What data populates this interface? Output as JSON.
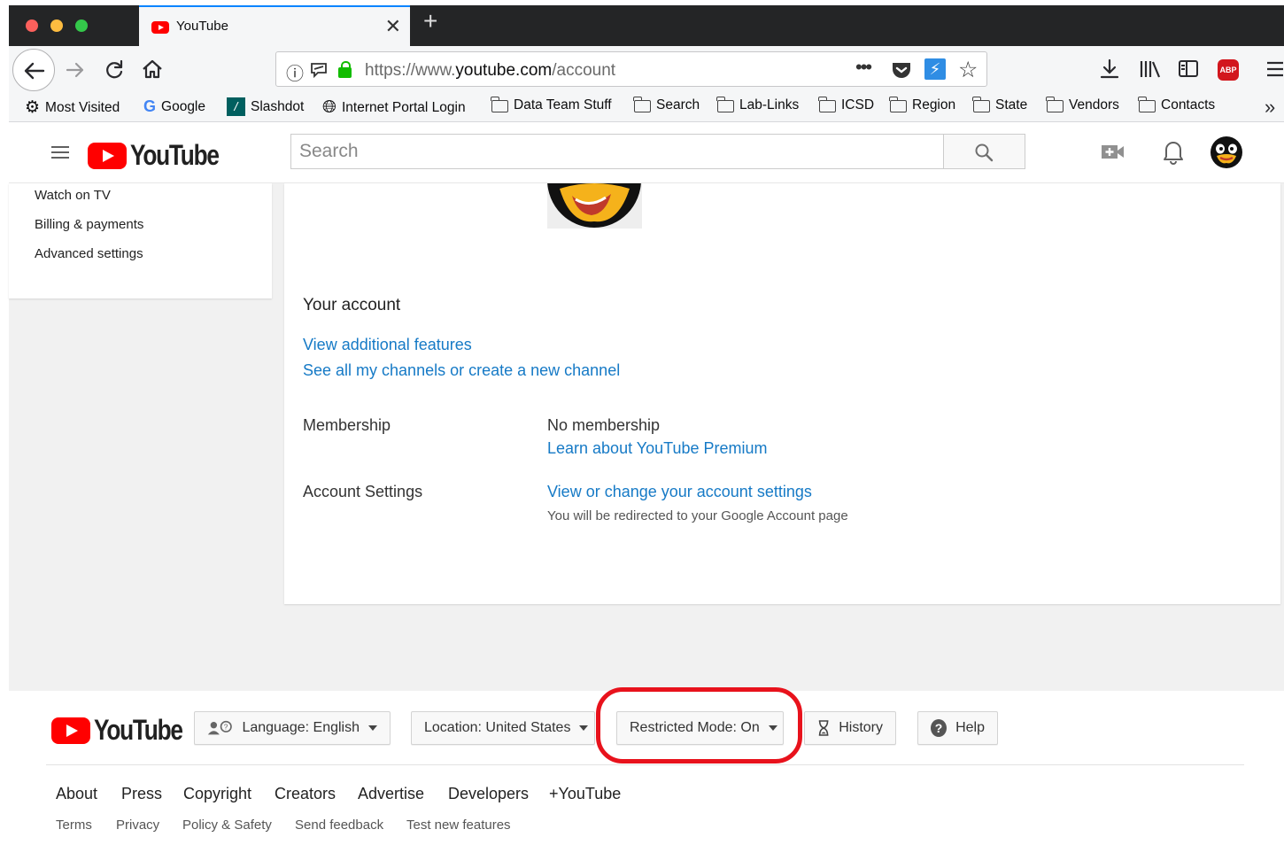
{
  "browser": {
    "tab_title": "YouTube",
    "url_prefix": "https://www.",
    "url_host": "youtube.com",
    "url_path": "/account",
    "abp_label": "ABP",
    "bookmarks": [
      "Most Visited",
      "Google",
      "Slashdot",
      "Internet Portal Login",
      "Data Team Stuff",
      "Search",
      "Lab-Links",
      "ICSD",
      "Region",
      "State",
      "Vendors",
      "Contacts"
    ]
  },
  "masthead": {
    "logo_text": "YouTube",
    "search_placeholder": "Search"
  },
  "sidebar": {
    "items": [
      "Watch on TV",
      "Billing & payments",
      "Advanced settings"
    ]
  },
  "account": {
    "title": "Your account",
    "view_features": "View additional features",
    "see_channels": "See all my channels or create a new channel",
    "membership_label": "Membership",
    "membership_value": "No membership",
    "membership_link": "Learn about YouTube Premium",
    "settings_label": "Account Settings",
    "settings_link": "View or change your account settings",
    "settings_note": "You will be redirected to your Google Account page"
  },
  "footer": {
    "logo_text": "YouTube",
    "language": "Language: English",
    "location": "Location: United States",
    "restricted": "Restricted Mode: On",
    "history": "History",
    "help": "Help",
    "links_primary": [
      "About",
      "Press",
      "Copyright",
      "Creators",
      "Advertise",
      "Developers",
      "+YouTube"
    ],
    "links_secondary": [
      "Terms",
      "Privacy",
      "Policy & Safety",
      "Send feedback",
      "Test new features"
    ]
  },
  "colors": {
    "brand_red": "#ff0000",
    "link_blue": "#167ac6",
    "highlight_red": "#e8121c"
  }
}
